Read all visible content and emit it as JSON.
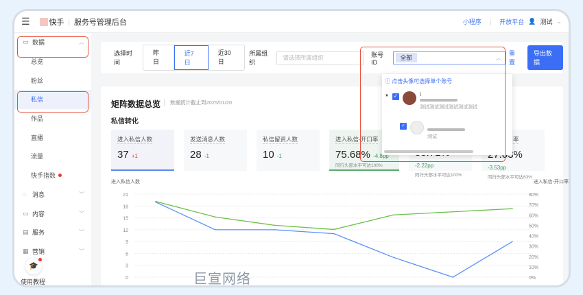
{
  "header": {
    "brand": "快手",
    "title": "服务号管理后台",
    "links": [
      "小程序",
      "开放平台"
    ],
    "user": "测试"
  },
  "sidebar": {
    "items": [
      {
        "label": "数据",
        "icon": "data-icon",
        "type": "group",
        "expanded": true
      },
      {
        "label": "总览",
        "type": "sub"
      },
      {
        "label": "粉丝",
        "type": "sub"
      },
      {
        "label": "私信",
        "type": "sub",
        "active": true
      },
      {
        "label": "作品",
        "type": "sub"
      },
      {
        "label": "直播",
        "type": "sub"
      },
      {
        "label": "流量",
        "type": "sub"
      },
      {
        "label": "快手指数",
        "type": "sub",
        "badge": true
      },
      {
        "label": "消息",
        "icon": "message-icon",
        "type": "group"
      },
      {
        "label": "内容",
        "icon": "video-icon",
        "type": "group"
      },
      {
        "label": "服务",
        "icon": "service-icon",
        "type": "group"
      },
      {
        "label": "营销",
        "icon": "grid-icon",
        "type": "group"
      }
    ],
    "help": "使用教程"
  },
  "filter": {
    "time_label": "选择时间",
    "time_options": [
      "昨日",
      "近7日",
      "近30日"
    ],
    "selected": "近7日",
    "org_label": "所属组织",
    "org_placeholder": "请选择所属组织",
    "account_label": "账号ID",
    "account_value": "全部",
    "reset": "重置",
    "export": "导出数据"
  },
  "dropdown": {
    "tip": "点击头像可选择单个账号",
    "accounts": [
      {
        "name": "t",
        "desc": "测试测试测试测试测试测试"
      },
      {
        "name": "",
        "desc": "测试"
      }
    ]
  },
  "card": {
    "title": "矩阵数据总览",
    "subtitle": "数据统计截止到2025/01/20",
    "section": "私信转化",
    "kpis": [
      {
        "label": "进入私信人数",
        "value": "37",
        "delta": "+1",
        "dir": "up"
      },
      {
        "label": "发送消息人数",
        "value": "28",
        "delta": "-1",
        "dir": "down"
      },
      {
        "label": "私信留资人数",
        "value": "10",
        "delta": "-1",
        "dir": "down"
      },
      {
        "label": "进入私信-开口率",
        "value": "75.68%",
        "delta": "-4.8pp",
        "dir": "down",
        "note": "同行头部水平可达100%"
      },
      {
        "label": "",
        "value": "55.71%",
        "delta": "-2.22pp",
        "dir": "down",
        "note": "同行头部水平可达100%"
      },
      {
        "label": "私信-留资率",
        "value": "27.03%",
        "delta": "-3.53pp",
        "dir": "down",
        "note": "同行头部水平可达63%"
      }
    ]
  },
  "chart_data": {
    "type": "line",
    "ylabel": "进入私信人数",
    "y2label": "进入私信-开口率",
    "ylim": [
      0,
      21
    ],
    "yticks": [
      "21",
      "18",
      "15",
      "12",
      "9",
      "6",
      "3",
      "0"
    ],
    "y2lim": [
      0,
      80
    ],
    "y2ticks": [
      "80%",
      "70%",
      "60%",
      "50%",
      "40%",
      "30%",
      "20%",
      "10%",
      "0%"
    ],
    "series": [
      {
        "name": "进入私信人数",
        "axis": "left",
        "color": "#5b8ff9",
        "values": [
          19,
          12,
          12,
          11,
          5,
          0,
          9
        ]
      },
      {
        "name": "进入私信-开口率",
        "axis": "right",
        "color": "#6bc04b",
        "values": [
          73,
          58,
          50,
          46,
          60,
          63,
          66
        ]
      }
    ]
  },
  "watermark": "巨宣网络",
  "colors": {
    "accent": "#3b6ef5",
    "highlight": "#e5533c"
  }
}
